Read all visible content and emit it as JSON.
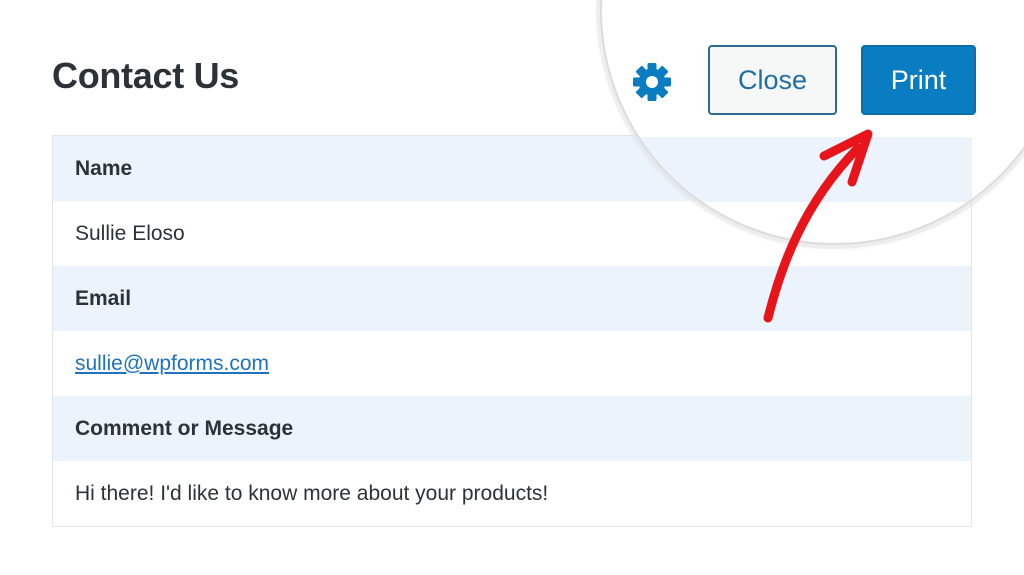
{
  "header": {
    "title": "Contact Us",
    "close_label": "Close",
    "print_label": "Print",
    "settings_icon": "gear-icon"
  },
  "entry": {
    "fields": [
      {
        "label": "Name",
        "value": "Sullie Eloso"
      },
      {
        "label": "Email",
        "value": "sullie@wpforms.com"
      },
      {
        "label": "Comment or Message",
        "value": "Hi there! I'd like to know more about your products!"
      }
    ]
  },
  "colors": {
    "accent": "#0a7cc1",
    "label_row_bg": "#ebf3fc",
    "link": "#1e73be",
    "annotation_arrow": "#e8141c"
  }
}
